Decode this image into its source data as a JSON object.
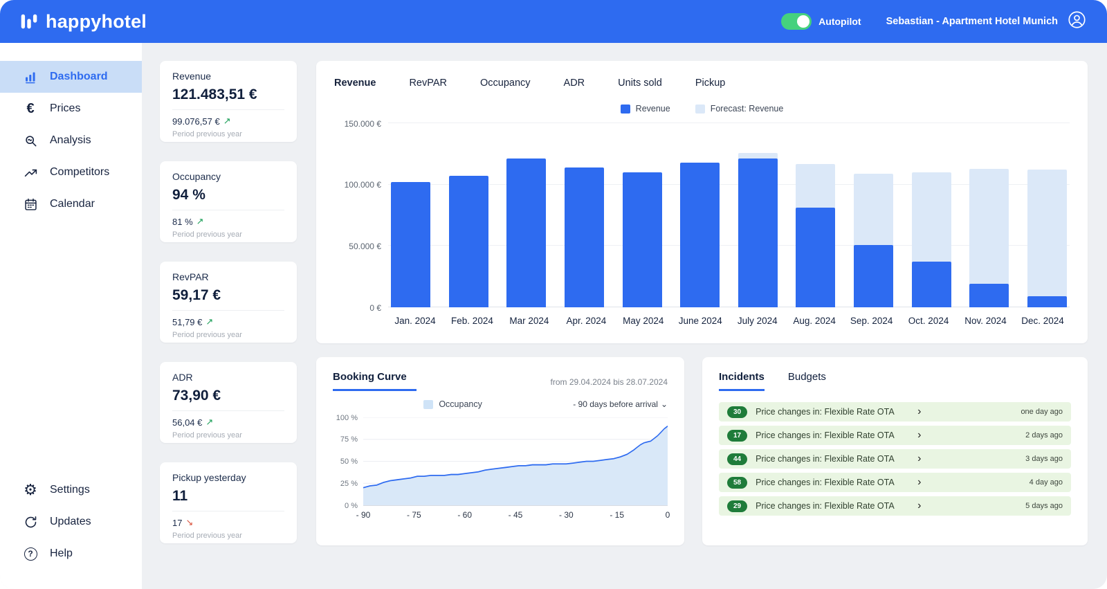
{
  "colors": {
    "accent": "#2e6bf0",
    "forecast": "#dbe8f8",
    "positive": "#1a9e57",
    "negative": "#d9503a",
    "toggle_on": "#45d17e",
    "active_item_bg": "#c9ddf7",
    "incident_bg": "#e9f5e2",
    "badge": "#1f7c3a"
  },
  "topbar": {
    "brand": "happyhotel",
    "autopilot_label": "Autopilot",
    "autopilot_on": true,
    "user_label": "Sebastian - Apartment Hotel Munich"
  },
  "sidebar": {
    "items": [
      {
        "label": "Dashboard",
        "icon": "dashboard-icon",
        "active": true
      },
      {
        "label": "Prices",
        "icon": "euro-icon",
        "active": false
      },
      {
        "label": "Analysis",
        "icon": "analysis-icon",
        "active": false
      },
      {
        "label": "Competitors",
        "icon": "competitors-icon",
        "active": false
      },
      {
        "label": "Calendar",
        "icon": "calendar-icon",
        "active": false
      }
    ],
    "bottom_items": [
      {
        "label": "Settings",
        "icon": "settings-icon",
        "active": false
      },
      {
        "label": "Updates",
        "icon": "updates-icon",
        "active": false
      },
      {
        "label": "Help",
        "icon": "help-icon",
        "active": false
      }
    ]
  },
  "kpi_cards": [
    {
      "title": "Revenue",
      "value": "121.483,51 €",
      "previous": "99.076,57 €",
      "trend": "up",
      "period_label": "Period previous year"
    },
    {
      "title": "Occupancy",
      "value": "94 %",
      "previous": "81 %",
      "trend": "up",
      "period_label": "Period previous year"
    },
    {
      "title": "RevPAR",
      "value": "59,17 €",
      "previous": "51,79 €",
      "trend": "up",
      "period_label": "Period previous year"
    },
    {
      "title": "ADR",
      "value": "73,90 €",
      "previous": "56,04 €",
      "trend": "up",
      "period_label": "Period previous year"
    },
    {
      "title": "Pickup yesterday",
      "value": "11",
      "previous": "17",
      "trend": "down",
      "period_label": "Period previous year"
    }
  ],
  "main_chart": {
    "tabs": [
      "Revenue",
      "RevPAR",
      "Occupancy",
      "ADR",
      "Units sold",
      "Pickup"
    ],
    "active_tab": "Revenue",
    "legend": [
      {
        "label": "Revenue",
        "color": "#2e6bf0"
      },
      {
        "label": "Forecast: Revenue",
        "color": "#dbe8f8"
      }
    ]
  },
  "booking_curve": {
    "title": "Booking Curve",
    "range_label": "from 29.04.2024 bis 28.07.2024",
    "legend_label": "Occupancy",
    "legend_color": "#cfe3f7",
    "dropdown_label": "- 90 days before arrival",
    "dropdown_chevron": "⌄"
  },
  "incidents": {
    "tabs": [
      "Incidents",
      "Budgets"
    ],
    "active_tab": "Incidents",
    "rows": [
      {
        "count": "30",
        "text": "Price changes in: Flexible Rate OTA",
        "time": "one day ago"
      },
      {
        "count": "17",
        "text": "Price changes in: Flexible Rate OTA",
        "time": "2 days ago"
      },
      {
        "count": "44",
        "text": "Price changes in: Flexible Rate OTA",
        "time": "3 days ago"
      },
      {
        "count": "58",
        "text": "Price changes in: Flexible Rate OTA",
        "time": "4 day ago"
      },
      {
        "count": "29",
        "text": "Price changes in: Flexible Rate OTA",
        "time": "5 days ago"
      }
    ]
  },
  "chart_data": [
    {
      "id": "revenue_by_month",
      "type": "bar",
      "title": "Revenue by month with forecast",
      "categories": [
        "Jan. 2024",
        "Feb. 2024",
        "Mar 2024",
        "Apr. 2024",
        "May 2024",
        "June 2024",
        "July 2024",
        "Aug. 2024",
        "Sep. 2024",
        "Oct. 2024",
        "Nov. 2024",
        "Dec. 2024"
      ],
      "series": [
        {
          "name": "Revenue",
          "color": "#2e6bf0",
          "values": [
            102000,
            107000,
            121000,
            114000,
            110000,
            118000,
            121000,
            81000,
            51000,
            37000,
            19000,
            9000
          ]
        },
        {
          "name": "Forecast: Revenue",
          "color": "#dbe8f8",
          "stacked_on_revenue": true,
          "values": [
            0,
            0,
            0,
            0,
            0,
            0,
            5000,
            36000,
            58000,
            73000,
            94000,
            103000
          ]
        }
      ],
      "ylim": [
        0,
        150000
      ],
      "ytick_values": [
        0,
        50000,
        100000,
        150000
      ],
      "ytick_labels": [
        "0 €",
        "50.000 €",
        "100.000 €",
        "150.000 €"
      ],
      "grid": true,
      "legend_position": "top-center"
    },
    {
      "id": "booking_curve",
      "type": "area",
      "title": "Booking Curve",
      "series_name": "Occupancy",
      "xlim": [
        -90,
        0
      ],
      "ylim": [
        0,
        100
      ],
      "xtick_labels": [
        "- 90",
        "- 75",
        "- 60",
        "- 45",
        "- 30",
        "- 15",
        "0"
      ],
      "ytick_labels": [
        "0 %",
        "25 %",
        "50 %",
        "75 %",
        "100 %"
      ],
      "points": [
        [
          -90,
          20
        ],
        [
          -88,
          22
        ],
        [
          -86,
          23
        ],
        [
          -84,
          26
        ],
        [
          -82,
          28
        ],
        [
          -80,
          29
        ],
        [
          -78,
          30
        ],
        [
          -76,
          31
        ],
        [
          -74,
          33
        ],
        [
          -72,
          33
        ],
        [
          -70,
          34
        ],
        [
          -68,
          34
        ],
        [
          -66,
          34
        ],
        [
          -64,
          35
        ],
        [
          -62,
          35
        ],
        [
          -60,
          36
        ],
        [
          -58,
          37
        ],
        [
          -56,
          38
        ],
        [
          -54,
          40
        ],
        [
          -52,
          41
        ],
        [
          -50,
          42
        ],
        [
          -48,
          43
        ],
        [
          -46,
          44
        ],
        [
          -44,
          45
        ],
        [
          -42,
          45
        ],
        [
          -40,
          46
        ],
        [
          -38,
          46
        ],
        [
          -36,
          46
        ],
        [
          -34,
          47
        ],
        [
          -32,
          47
        ],
        [
          -30,
          47
        ],
        [
          -28,
          48
        ],
        [
          -26,
          49
        ],
        [
          -24,
          50
        ],
        [
          -22,
          50
        ],
        [
          -20,
          51
        ],
        [
          -18,
          52
        ],
        [
          -16,
          53
        ],
        [
          -14,
          55
        ],
        [
          -12,
          58
        ],
        [
          -10,
          63
        ],
        [
          -9,
          66
        ],
        [
          -8,
          69
        ],
        [
          -7,
          71
        ],
        [
          -6,
          72
        ],
        [
          -5,
          73
        ],
        [
          -4,
          76
        ],
        [
          -3,
          79
        ],
        [
          -2,
          83
        ],
        [
          -1,
          87
        ],
        [
          0,
          90
        ]
      ],
      "line_color": "#2e6bf0",
      "fill_color": "#d9e8f8",
      "grid": true
    }
  ]
}
